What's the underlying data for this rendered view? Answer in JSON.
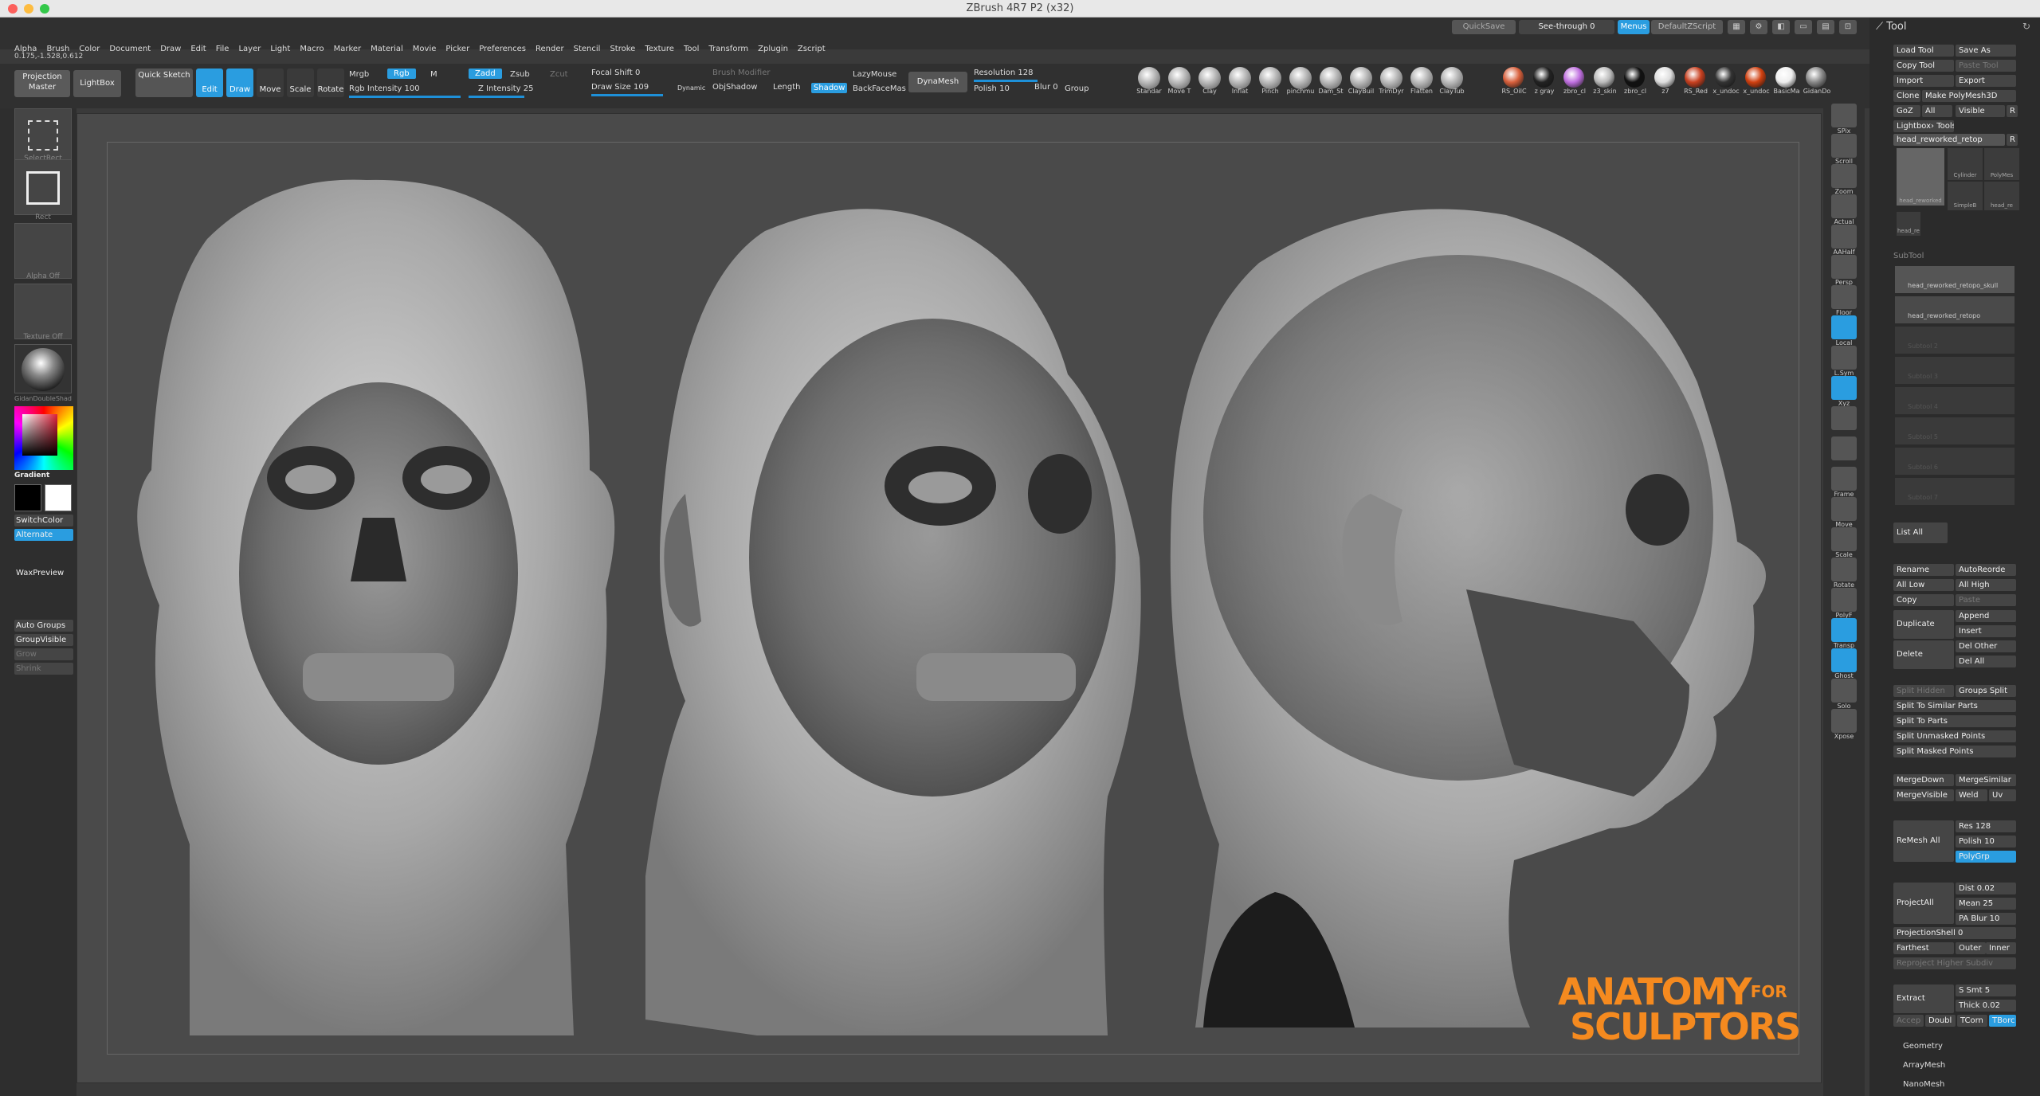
{
  "window": {
    "title": "ZBrush 4R7 P2 (x32)"
  },
  "topbar": {
    "quicksave": "QuickSave",
    "see_through": "See-through  0",
    "menus": "Menus",
    "default_zscript": "DefaultZScript"
  },
  "menu": [
    "Alpha",
    "Brush",
    "Color",
    "Document",
    "Draw",
    "Edit",
    "File",
    "Layer",
    "Light",
    "Macro",
    "Marker",
    "Material",
    "Movie",
    "Picker",
    "Preferences",
    "Render",
    "Stencil",
    "Stroke",
    "Texture",
    "Tool",
    "Transform",
    "Zplugin",
    "Zscript"
  ],
  "coords": "0.175,-1.528,0.612",
  "shelf": {
    "projection_master": "Projection Master",
    "lightbox": "LightBox",
    "quick_sketch": "Quick Sketch",
    "edit": "Edit",
    "draw": "Draw",
    "move": "Move",
    "scale": "Scale",
    "rotate": "Rotate",
    "mrgb": "Mrgb",
    "rgb": "Rgb",
    "m": "M",
    "rgb_intensity": "Rgb Intensity 100",
    "zadd": "Zadd",
    "zsub": "Zsub",
    "zcut": "Zcut",
    "z_intensity": "Z Intensity 25",
    "focal_shift": "Focal Shift 0",
    "draw_size": "Draw Size 109",
    "dynamic": "Dynamic",
    "brush_modifier": "Brush Modifier",
    "objshadow": "ObjShadow",
    "length": "Length",
    "shadow": "Shadow",
    "lazymouse": "LazyMouse",
    "backfacemask": "BackFaceMas",
    "dynamesh": "DynaMesh",
    "resolution": "Resolution 128",
    "polish": "Polish 10",
    "blur": "Blur 0",
    "group": "Group"
  },
  "brushes": [
    "Standar",
    "Move T",
    "Clay",
    "Inflat",
    "Pinch",
    "pinchmu",
    "Dam_St",
    "ClayBuil",
    "TrimDyr",
    "Flatten",
    "ClayTub"
  ],
  "materials": [
    {
      "label": "RS_OiIC",
      "color": "#d8603c"
    },
    {
      "label": "z gray",
      "color": "#222222"
    },
    {
      "label": "zbro_cl",
      "color": "#c070e0"
    },
    {
      "label": "z3_skin",
      "color": "#bbbbbb"
    },
    {
      "label": "zbro_cl",
      "color": "#111111"
    },
    {
      "label": "z7",
      "color": "#dddddd"
    },
    {
      "label": "RS_Red",
      "color": "#c84020"
    },
    {
      "label": "x_undoc",
      "color": "#333333"
    },
    {
      "label": "x_undoc",
      "color": "#d04010"
    },
    {
      "label": "BasicMa",
      "color": "#eeeeee"
    },
    {
      "label": "GidanDo",
      "color": "#888888"
    }
  ],
  "left": {
    "select_rect": "SelectRect",
    "rect": "Rect",
    "alpha_off": "Alpha  Off",
    "texture_off": "Texture  Off",
    "material": "GidanDoubleShad",
    "gradient": "Gradient",
    "switch_color": "SwitchColor",
    "alternate": "Alternate",
    "wax_preview": "WaxPreview",
    "auto_groups": "Auto Groups",
    "group_visible": "GroupVisible",
    "grow": "Grow",
    "shrink": "Shrink"
  },
  "right_strip": [
    "SPix",
    "Scroll",
    "Zoom",
    "Actual",
    "AAHalf",
    "Persp",
    "Floor",
    "Local",
    "L.Sym",
    "Xyz",
    "",
    "",
    "Frame",
    "Move",
    "Scale",
    "Rotate",
    "PolyF",
    "Transp",
    "Ghost",
    "Solo",
    "Xpose"
  ],
  "tool": {
    "title": "Tool",
    "load": "Load Tool",
    "save_as": "Save As",
    "copy": "Copy Tool",
    "paste": "Paste Tool",
    "import": "Import",
    "export": "Export",
    "clone": "Clone",
    "make_polymesh": "Make PolyMesh3D",
    "goz": "GoZ",
    "all": "All",
    "visible": "Visible",
    "r": "R",
    "lightbox_tools": "Lightbox› Tools",
    "current_tool": "head_reworked_retop",
    "r2": "R",
    "thumbs": [
      "head_reworked",
      "Cylinder",
      "PolyMes",
      "SimpleB",
      "head_re",
      "head_re"
    ],
    "subtool_title": "SubTool",
    "subtools": [
      "head_reworked_retopo_skull",
      "head_reworked_retopo",
      "Subtool 2",
      "Subtool 3",
      "Subtool 4",
      "Subtool 5",
      "Subtool 6",
      "Subtool 7"
    ],
    "list_all": "List  All",
    "rename": "Rename",
    "autoreorder": "AutoReorde",
    "all_low": "All Low",
    "all_high": "All High",
    "copy2": "Copy",
    "paste2": "Paste",
    "duplicate": "Duplicate",
    "append": "Append",
    "insert": "Insert",
    "delete": "Delete",
    "del_other": "Del Other",
    "del_all": "Del All",
    "split_hidden": "Split Hidden",
    "groups_split": "Groups Split",
    "split_similar": "Split To Similar Parts",
    "split_parts": "Split To Parts",
    "split_unmasked": "Split Unmasked Points",
    "split_masked": "Split Masked Points",
    "mergedown": "MergeDown",
    "mergesimilar": "MergeSimilar",
    "mergevisible": "MergeVisible",
    "weld": "Weld",
    "uv": "Uv",
    "remesh_all": "ReMesh All",
    "res": "Res 128",
    "polish": "Polish 10",
    "polygrp": "PolyGrp",
    "project_all": "ProjectAll",
    "dist": "Dist 0.02",
    "mean": "Mean 25",
    "pa_blur": "PA Blur 10",
    "projection_shell": "ProjectionShell 0",
    "farthest": "Farthest",
    "outer": "Outer",
    "inner": "Inner",
    "reproject": "Reproject Higher Subdiv",
    "extract": "Extract",
    "s_smt": "S Smt 5",
    "thick": "Thick 0.02",
    "accept": "Accep",
    "double": "Doubl",
    "tcorne": "TCorn",
    "tborder": "TBorc",
    "geometry": "Geometry",
    "arraymesh": "ArrayMesh",
    "nanomesh": "NanoMesh"
  },
  "logo": {
    "line1": "ANATOMY",
    "for": "FOR",
    "line2": "SCULPTORS",
    "color": "#f58a1f"
  },
  "accent": "#2a9de0"
}
